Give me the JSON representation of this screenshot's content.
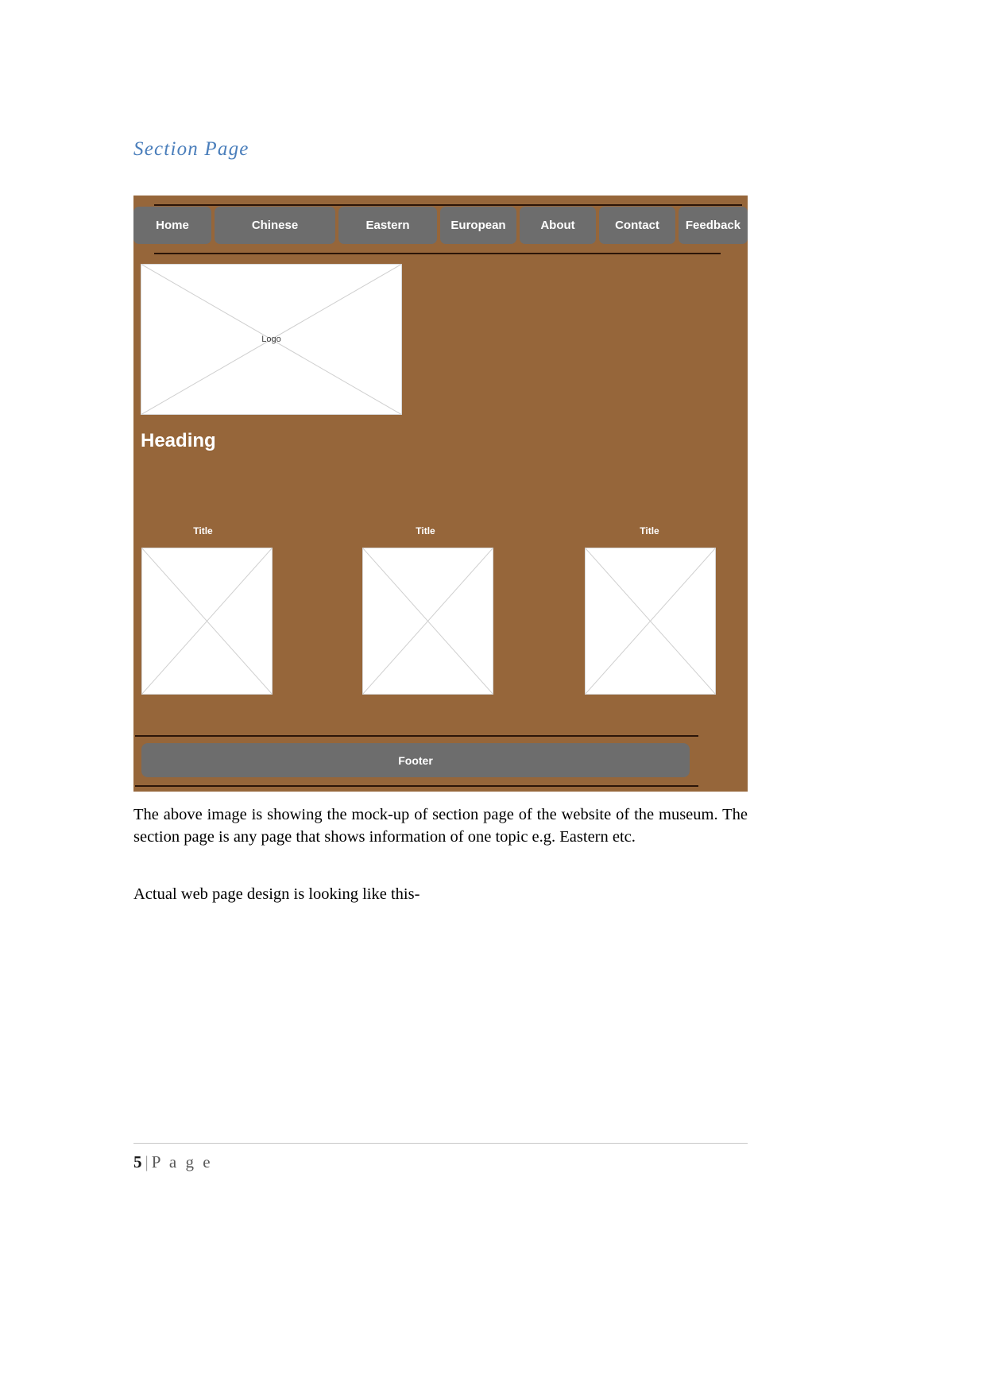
{
  "document": {
    "section_heading": "Section Page",
    "paragraphs": [
      "The above image is showing the mock-up of section page of the website of the museum. The section page is any page that shows information of one topic e.g. Eastern etc.",
      "Actual web page design is looking like this-"
    ],
    "page_footer": {
      "number": "5",
      "separator": "|",
      "word": "P a g e"
    }
  },
  "mockup": {
    "background_color": "#96663a",
    "button_color": "#6d6d6d",
    "nav": [
      {
        "label": "Home"
      },
      {
        "label": "Chinese"
      },
      {
        "label": "Eastern"
      },
      {
        "label": "European"
      },
      {
        "label": "About"
      },
      {
        "label": "Contact"
      },
      {
        "label": "Feedback"
      }
    ],
    "logo": {
      "label": "Logo"
    },
    "heading": "Heading",
    "cards": [
      {
        "title": "Title"
      },
      {
        "title": "Title"
      },
      {
        "title": "Title"
      }
    ],
    "footer": {
      "label": "Footer"
    }
  }
}
